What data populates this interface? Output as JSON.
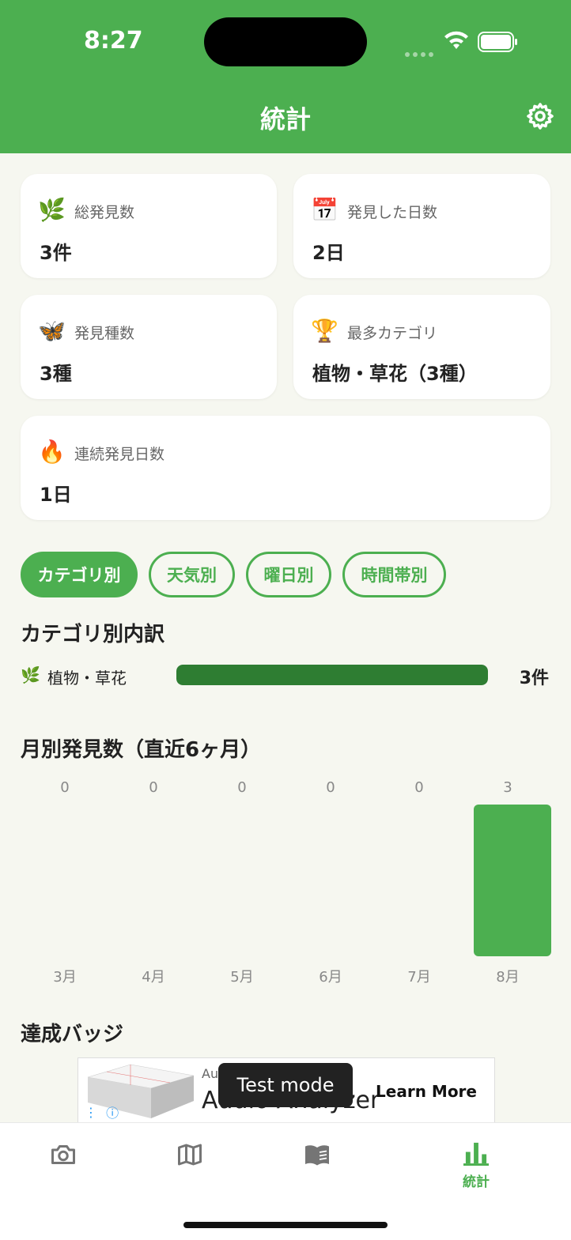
{
  "status_bar": {
    "time": "8:27"
  },
  "header": {
    "title": "統計",
    "settings_icon": "gear-icon"
  },
  "stats": [
    {
      "icon": "🌿",
      "label": "総発見数",
      "value": "3件"
    },
    {
      "icon": "📅",
      "label": "発見した日数",
      "value": "2日"
    },
    {
      "icon": "🦋",
      "label": "発見種数",
      "value": "3種"
    },
    {
      "icon": "🏆",
      "label": "最多カテゴリ",
      "value": "植物・草花（3種）"
    },
    {
      "icon": "🔥",
      "label": "連続発見日数",
      "value": "1日"
    }
  ],
  "segments": [
    {
      "label": "カテゴリ別",
      "active": true
    },
    {
      "label": "天気別",
      "active": false
    },
    {
      "label": "曜日別",
      "active": false
    },
    {
      "label": "時間帯別",
      "active": false
    }
  ],
  "category_section": {
    "title": "カテゴリ別内訳",
    "rows": [
      {
        "icon": "🌿",
        "label": "植物・草花",
        "count": "3件",
        "fraction": 1.0
      }
    ]
  },
  "monthly_section": {
    "title": "月別発見数（直近6ヶ月）"
  },
  "chart_data": {
    "type": "bar",
    "categories": [
      "3月",
      "4月",
      "5月",
      "6月",
      "7月",
      "8月"
    ],
    "values": [
      0,
      0,
      0,
      0,
      0,
      3
    ],
    "title": "月別発見数（直近6ヶ月）",
    "xlabel": "",
    "ylabel": "",
    "ylim": [
      0,
      3
    ],
    "grid": false,
    "bar_color": "#4caf50"
  },
  "badges_section": {
    "title": "達成バッジ"
  },
  "ad": {
    "app_name_partial": "Au",
    "app_name": "Audio Analyzer",
    "cta": "Learn More"
  },
  "toast": {
    "text": "Test mode"
  },
  "tabbar": {
    "items": [
      {
        "icon": "camera-icon",
        "label": ""
      },
      {
        "icon": "map-icon",
        "label": ""
      },
      {
        "icon": "book-icon",
        "label": ""
      },
      {
        "icon": "bar-chart-icon",
        "label": "統計",
        "active": true
      }
    ]
  },
  "colors": {
    "primary": "#4caf50",
    "dark_green": "#2e7d32",
    "background": "#f6f7f0"
  }
}
